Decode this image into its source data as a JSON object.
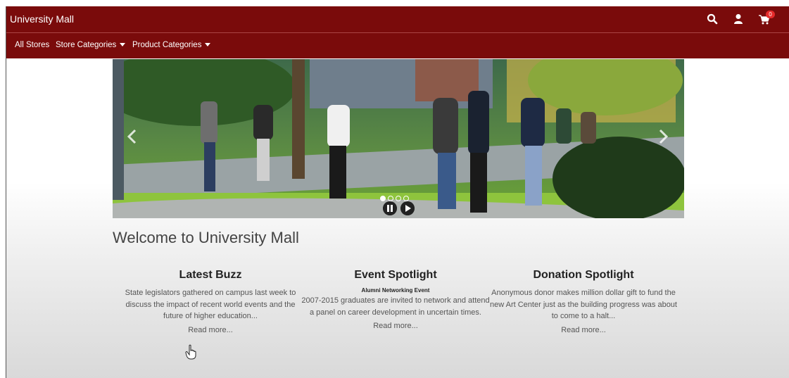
{
  "header": {
    "brand": "University Mall",
    "cart_count": "0",
    "icons": [
      "search-icon",
      "user-icon",
      "cart-icon"
    ]
  },
  "nav": {
    "items": [
      {
        "label": "All Stores"
      },
      {
        "label": "Store Categories"
      },
      {
        "label": "Product Categories"
      }
    ]
  },
  "carousel": {
    "slide_count": 4,
    "active_slide": 1
  },
  "main": {
    "welcome": "Welcome to University Mall",
    "columns": [
      {
        "title": "Latest Buzz",
        "subtitle": "",
        "body": "State legislators gathered on campus last week to discuss the impact of recent world events and the future of higher education...",
        "link": "Read more..."
      },
      {
        "title": "Event Spotlight",
        "subtitle": "Alumni Networking Event",
        "body": "2007-2015 graduates are invited to network and attend a panel on career development in uncertain times.",
        "link": "Read more..."
      },
      {
        "title": "Donation Spotlight",
        "subtitle": "",
        "body": "Anonymous donor makes million dollar gift to fund the new Art Center just as the building progress was about to come to a halt...",
        "link": "Read more..."
      }
    ]
  },
  "colors": {
    "header_bg": "#7a0b0b",
    "badge": "#e52a2a"
  }
}
